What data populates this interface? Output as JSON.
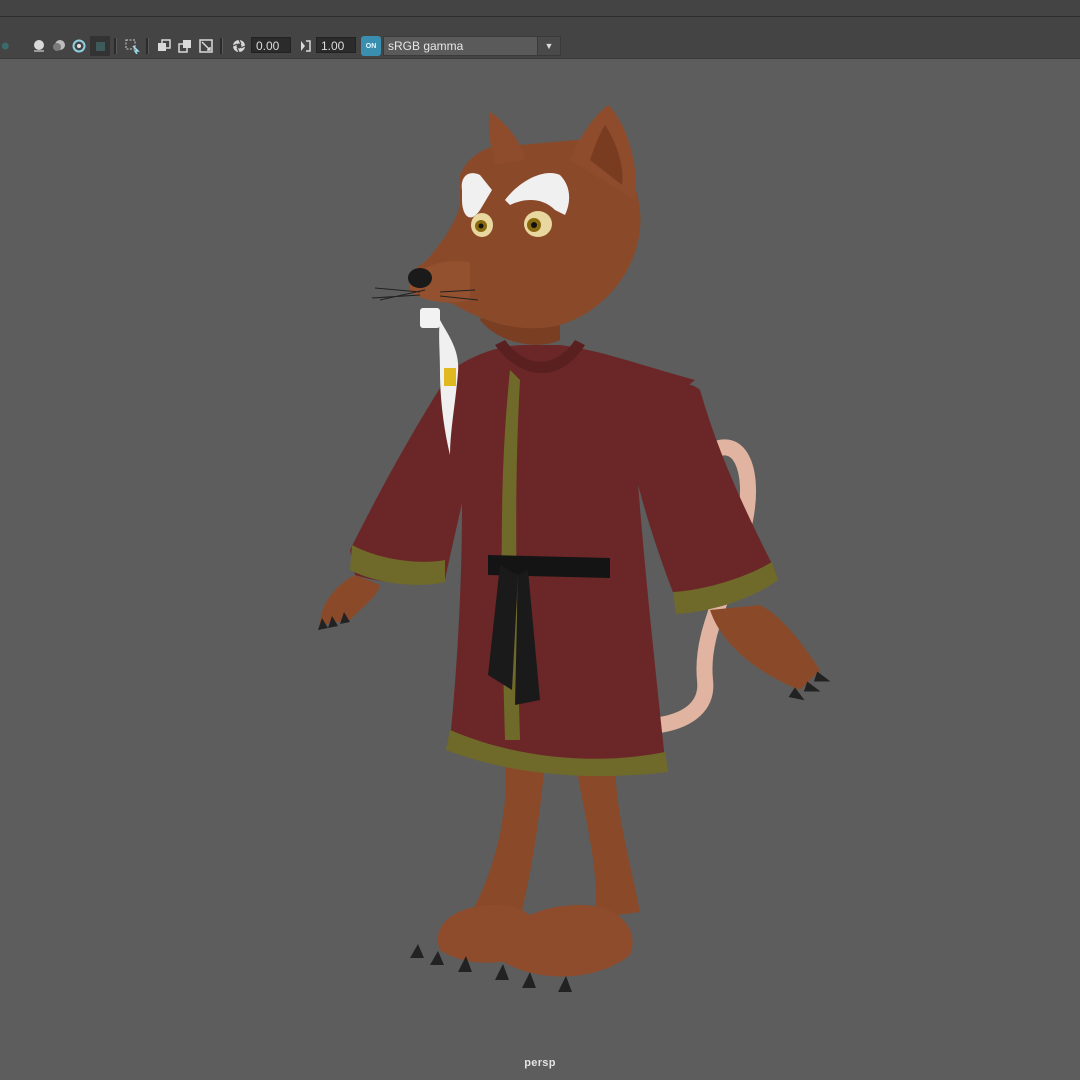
{
  "toolbar": {
    "exposure_value": "0.00",
    "gamma_value": "1.00",
    "color_management_badge": "ON",
    "color_space": "sRGB gamma",
    "icons": [
      "ao-icon",
      "lighting-icon",
      "shadow-icon",
      "isolate-icon",
      "xray-icon",
      "select-icon",
      "grid-icon",
      "wireframe-icon",
      "smooth-icon",
      "resolution-gate-icon",
      "exposure-icon",
      "gamma-icon"
    ]
  },
  "viewport": {
    "camera_label": "persp",
    "scene": "rat-character-model"
  },
  "colors": {
    "background": "#5d5d5d",
    "toolbar": "#444444",
    "accent": "#3a8fb0"
  }
}
